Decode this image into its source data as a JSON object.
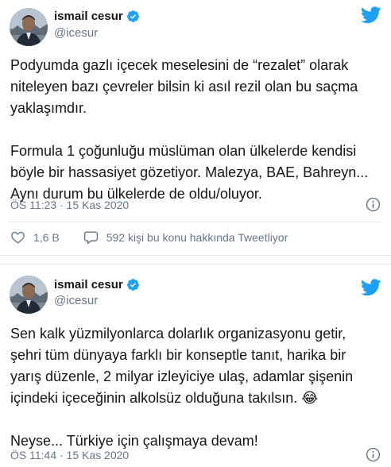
{
  "tweets": [
    {
      "author_name": "ismail cesur",
      "author_handle": "@icesur",
      "text": "Podyumda gazlı içecek meselesini de “rezalet” olarak\nniteleyen bazı çevreler bilsin ki asıl rezil olan bu saçma\nyaklaşımdır.\n\nFormula 1 çoğunluğu müslüman olan ülkelerde kendisi\nböyle bir hassasiyet gözetiyor. Malezya, BAE, Bahreyn...\nAynı durum bu ülkelerde de oldu/oluyor.",
      "timestamp": "ÖS 11:23 · 15 Kas 2020",
      "like_count": "1,6 B",
      "tweeting_text": "592 kişi bu konu hakkında Tweetliyor"
    },
    {
      "author_name": "ismail cesur",
      "author_handle": "@icesur",
      "text": "Sen kalk yüzmilyonlarca dolarlık organizasyonu getir,\nşehri tüm dünyaya farklı bir konseptle tanıt, harika bir\nyarış düzenle, 2 milyar izleyiciye ulaş, adamlar şişenin\niçindeki içeceğinin alkolsüz olduğuna takılsın. 😂\n\nNeyse... Türkiye için çalışmaya devam!",
      "timestamp": "ÖS 11:44 · 15 Kas 2020"
    }
  ],
  "icons": {
    "verified": "verified-badge-icon",
    "twitter": "twitter-bird-icon",
    "info": "info-icon",
    "like": "heart-icon",
    "reply": "speech-bubble-icon"
  },
  "colors": {
    "twitter_blue": "#1da1f2",
    "text": "#14171a",
    "secondary_text": "#657786",
    "border": "#e1e8ed"
  }
}
